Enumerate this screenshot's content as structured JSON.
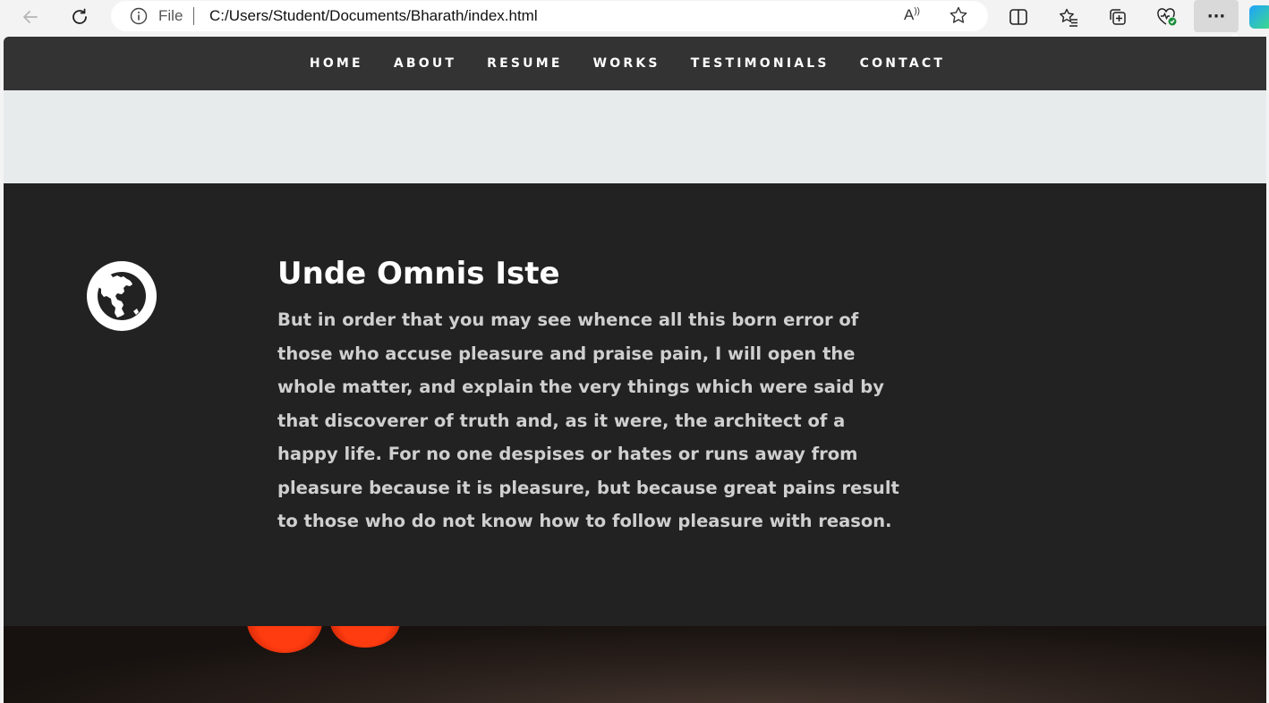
{
  "browser": {
    "address": {
      "scheme_label": "File",
      "url": "C:/Users/Student/Documents/Bharath/index.html",
      "read_aloud_label": "A"
    },
    "icons": [
      "back-arrow-icon",
      "refresh-icon",
      "info-icon",
      "read-aloud-icon",
      "favorite-star-icon",
      "split-screen-icon",
      "favorites-icon",
      "collections-icon",
      "browser-essentials-icon",
      "more-icon",
      "copilot-icon"
    ],
    "more_label": "···"
  },
  "nav": {
    "items": [
      {
        "label": "HOME"
      },
      {
        "label": "ABOUT"
      },
      {
        "label": "RESUME"
      },
      {
        "label": "WORKS"
      },
      {
        "label": "TESTIMONIALS"
      },
      {
        "label": "CONTACT"
      }
    ]
  },
  "about": {
    "icon": "globe-icon",
    "title": "Unde Omnis Iste",
    "text": "But in order that you may see whence all this born error of those who accuse pleasure and praise pain, I will open the whole matter, and explain the very things which were said by that discoverer of truth and, as it were, the architect of a happy life. For no one despises or hates or runs away from pleasure because it is pleasure, but because great pains result to those who do not know how to follow pleasure with reason."
  },
  "colors": {
    "nav_bg": "#333333",
    "section_bg": "#222222",
    "light_band": "#e8ebec",
    "text": "#cfcfcf",
    "bokeh": "#ff3b10"
  }
}
